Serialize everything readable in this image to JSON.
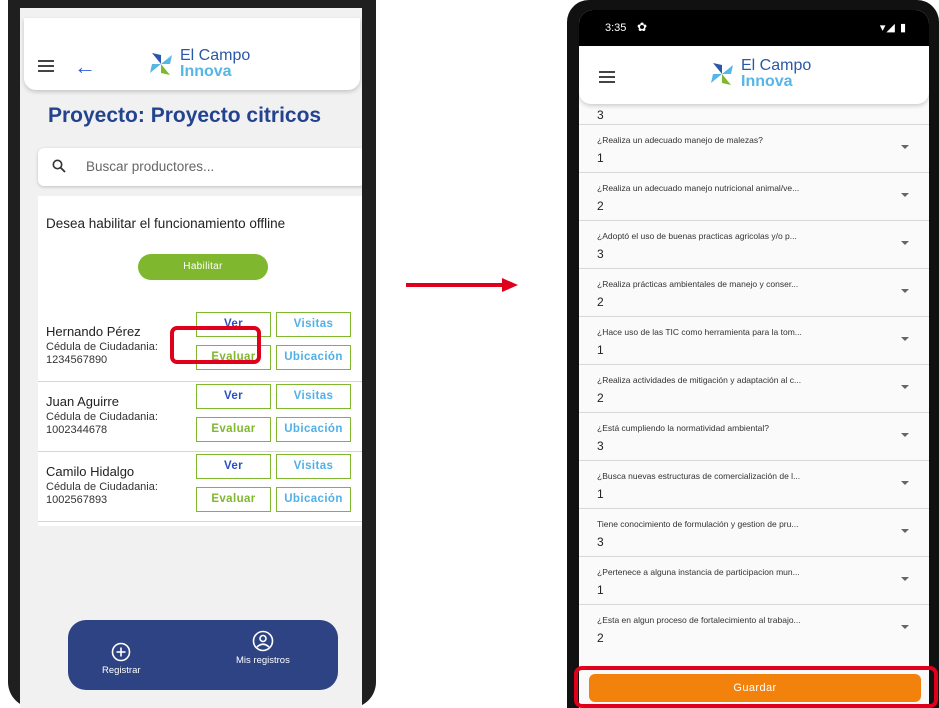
{
  "left_screen": {
    "logo": {
      "line1": "El Campo",
      "line2": "Innova"
    },
    "title": "Proyecto: Proyecto citricos",
    "search": {
      "placeholder": "Buscar productores..."
    },
    "offline": {
      "text": "Desea habilitar el funcionamiento offline",
      "button": "Habilitar"
    },
    "producers": [
      {
        "name": "Hernando Pérez",
        "doc_label": "Cédula de Ciudadania:",
        "doc_number": "1234567890"
      },
      {
        "name": "Juan Aguirre",
        "doc_label": "Cédula de Ciudadania:",
        "doc_number": "1002344678"
      },
      {
        "name": "Camilo Hidalgo",
        "doc_label": "Cédula de Ciudadania:",
        "doc_number": "1002567893"
      }
    ],
    "actions": {
      "ver": "Ver",
      "visitas": "Visitas",
      "evaluar": "Evaluar",
      "ubicacion": "Ubicación"
    },
    "nav": {
      "registrar": "Registrar",
      "mis_registros": "Mis registros"
    }
  },
  "right_screen": {
    "status": {
      "time": "3:35",
      "gear": "✿",
      "icons": "▾◢ ▮"
    },
    "logo": {
      "line1": "El Campo",
      "line2": "Innova"
    },
    "partial_value": "3",
    "questions": [
      {
        "text": "¿Realiza un adecuado manejo de malezas?",
        "value": "1"
      },
      {
        "text": "¿Realiza un adecuado manejo nutricional animal/ve...",
        "value": "2"
      },
      {
        "text": "¿Adoptó el uso de buenas practicas agricolas y/o p...",
        "value": "3"
      },
      {
        "text": "¿Realiza prácticas ambientales de manejo y conser...",
        "value": "2"
      },
      {
        "text": "¿Hace uso de las TIC como herramienta para la tom...",
        "value": "1"
      },
      {
        "text": "¿Realiza actividades de mitigación y adaptación al c...",
        "value": "2"
      },
      {
        "text": "¿Está cumpliendo la normatividad ambiental?",
        "value": "3"
      },
      {
        "text": "¿Busca nuevas estructuras de comercialización de l...",
        "value": "1"
      },
      {
        "text": "Tiene conocimiento de formulación y gestion de pru...",
        "value": "3"
      },
      {
        "text": "¿Pertenece a alguna instancia de participacion mun...",
        "value": "1"
      },
      {
        "text": "¿Esta en algun proceso de fortalecimiento al trabajo...",
        "value": "2"
      }
    ],
    "save_button": "Guardar"
  },
  "colors": {
    "brand_blue": "#2d4383",
    "accent_green": "#7fb82f",
    "orange": "#f2820c",
    "highlight_red": "#e0001c"
  }
}
